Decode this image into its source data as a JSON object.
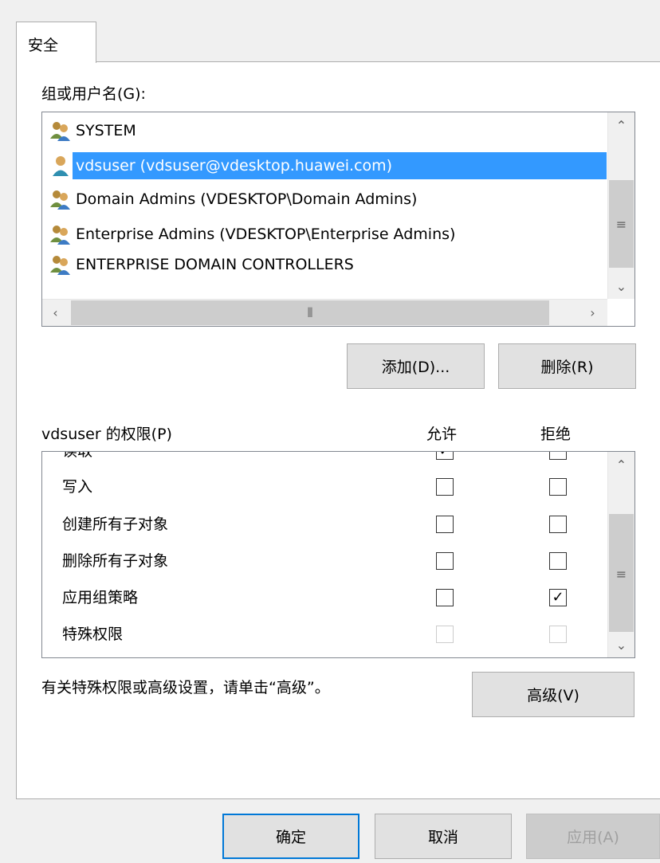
{
  "tab": {
    "label": "安全"
  },
  "groups": {
    "label": "组或用户名(G):",
    "items": [
      {
        "name": "SYSTEM",
        "icon": "group-icon"
      },
      {
        "name": "vdsuser (vdsuser@vdesktop.huawei.com)",
        "icon": "user-icon",
        "selected": true
      },
      {
        "name": "Domain Admins (VDESKTOP\\Domain Admins)",
        "icon": "group-icon"
      },
      {
        "name": "Enterprise Admins (VDESKTOP\\Enterprise Admins)",
        "icon": "group-icon"
      },
      {
        "name": "ENTERPRISE DOMAIN CONTROLLERS",
        "icon": "group-icon"
      }
    ]
  },
  "buttons": {
    "add": "添加(D)...",
    "remove": "删除(R)",
    "advanced": "高级(V)",
    "ok": "确定",
    "cancel": "取消",
    "apply": "应用(A)"
  },
  "permissions": {
    "label": "vdsuser 的权限(P)",
    "allow_header": "允许",
    "deny_header": "拒绝",
    "rows": [
      {
        "name": "读取",
        "allow": true,
        "deny": false
      },
      {
        "name": "写入",
        "allow": false,
        "deny": false
      },
      {
        "name": "创建所有子对象",
        "allow": false,
        "deny": false
      },
      {
        "name": "删除所有子对象",
        "allow": false,
        "deny": false
      },
      {
        "name": "应用组策略",
        "allow": false,
        "deny": true
      },
      {
        "name": "特殊权限",
        "allow": false,
        "deny": false,
        "disabled": true
      }
    ]
  },
  "advanced_hint": "有关特殊权限或高级设置，请单击“高级”。",
  "colors": {
    "selection": "#3399ff",
    "panel_bg": "#ffffff",
    "dialog_bg": "#f0f0f0"
  }
}
